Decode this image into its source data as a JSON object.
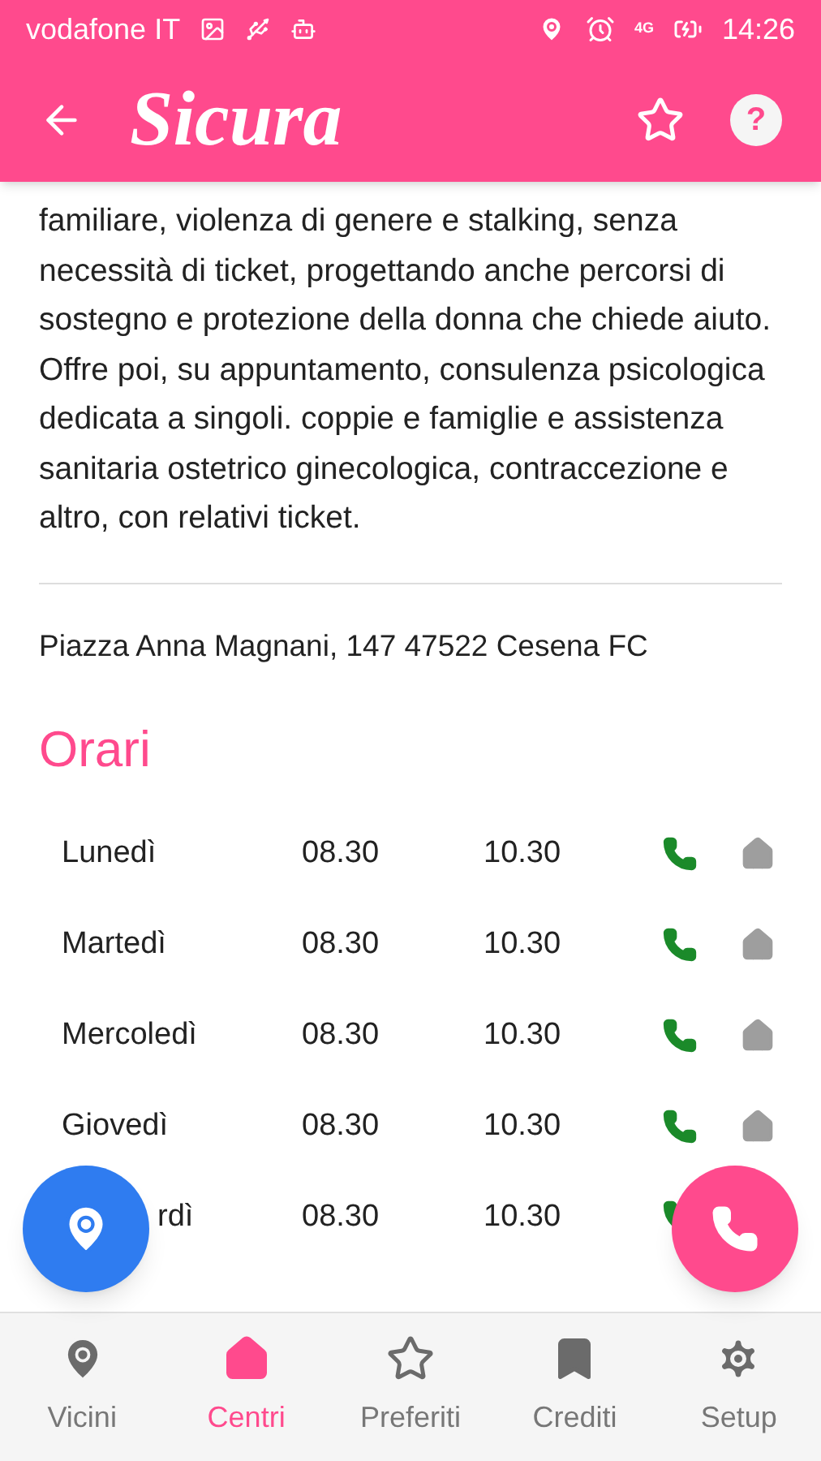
{
  "status_bar": {
    "carrier": "vodafone IT",
    "network": "4G",
    "time": "14:26"
  },
  "app_bar": {
    "title": "Sicura",
    "favorite": false,
    "help": "?"
  },
  "description": "familiare, violenza di genere e stalking, senza necessità di ticket, progettando anche percorsi di sostegno e protezione della donna che chiede aiuto. Offre poi, su appuntamento, consulenza psicologica dedicata a singoli. coppie e famiglie e assistenza sanitaria ostetrico ginecologica, contraccezione e altro, con relativi ticket.",
  "address": "Piazza Anna Magnani, 147 47522 Cesena FC",
  "hours_title": "Orari",
  "hours": [
    {
      "day": "Lunedì",
      "from": "08.30",
      "to": "10.30",
      "phone": true,
      "visit": false,
      "covered": false
    },
    {
      "day": "Martedì",
      "from": "08.30",
      "to": "10.30",
      "phone": true,
      "visit": false,
      "covered": false
    },
    {
      "day": "Mercoledì",
      "from": "08.30",
      "to": "10.30",
      "phone": true,
      "visit": false,
      "covered": false
    },
    {
      "day": "Giovedì",
      "from": "08.30",
      "to": "10.30",
      "phone": true,
      "visit": false,
      "covered": false
    },
    {
      "day": "rdì",
      "from": "08.30",
      "to": "10.30",
      "phone": true,
      "covered": true
    }
  ],
  "bottom_nav": [
    {
      "label": "Vicini",
      "kind": "pin",
      "selected": false
    },
    {
      "label": "Centri",
      "kind": "home",
      "selected": true
    },
    {
      "label": "Preferiti",
      "kind": "star",
      "selected": false
    },
    {
      "label": "Crediti",
      "kind": "bookmark",
      "selected": false
    },
    {
      "label": "Setup",
      "kind": "gear",
      "selected": false
    }
  ]
}
